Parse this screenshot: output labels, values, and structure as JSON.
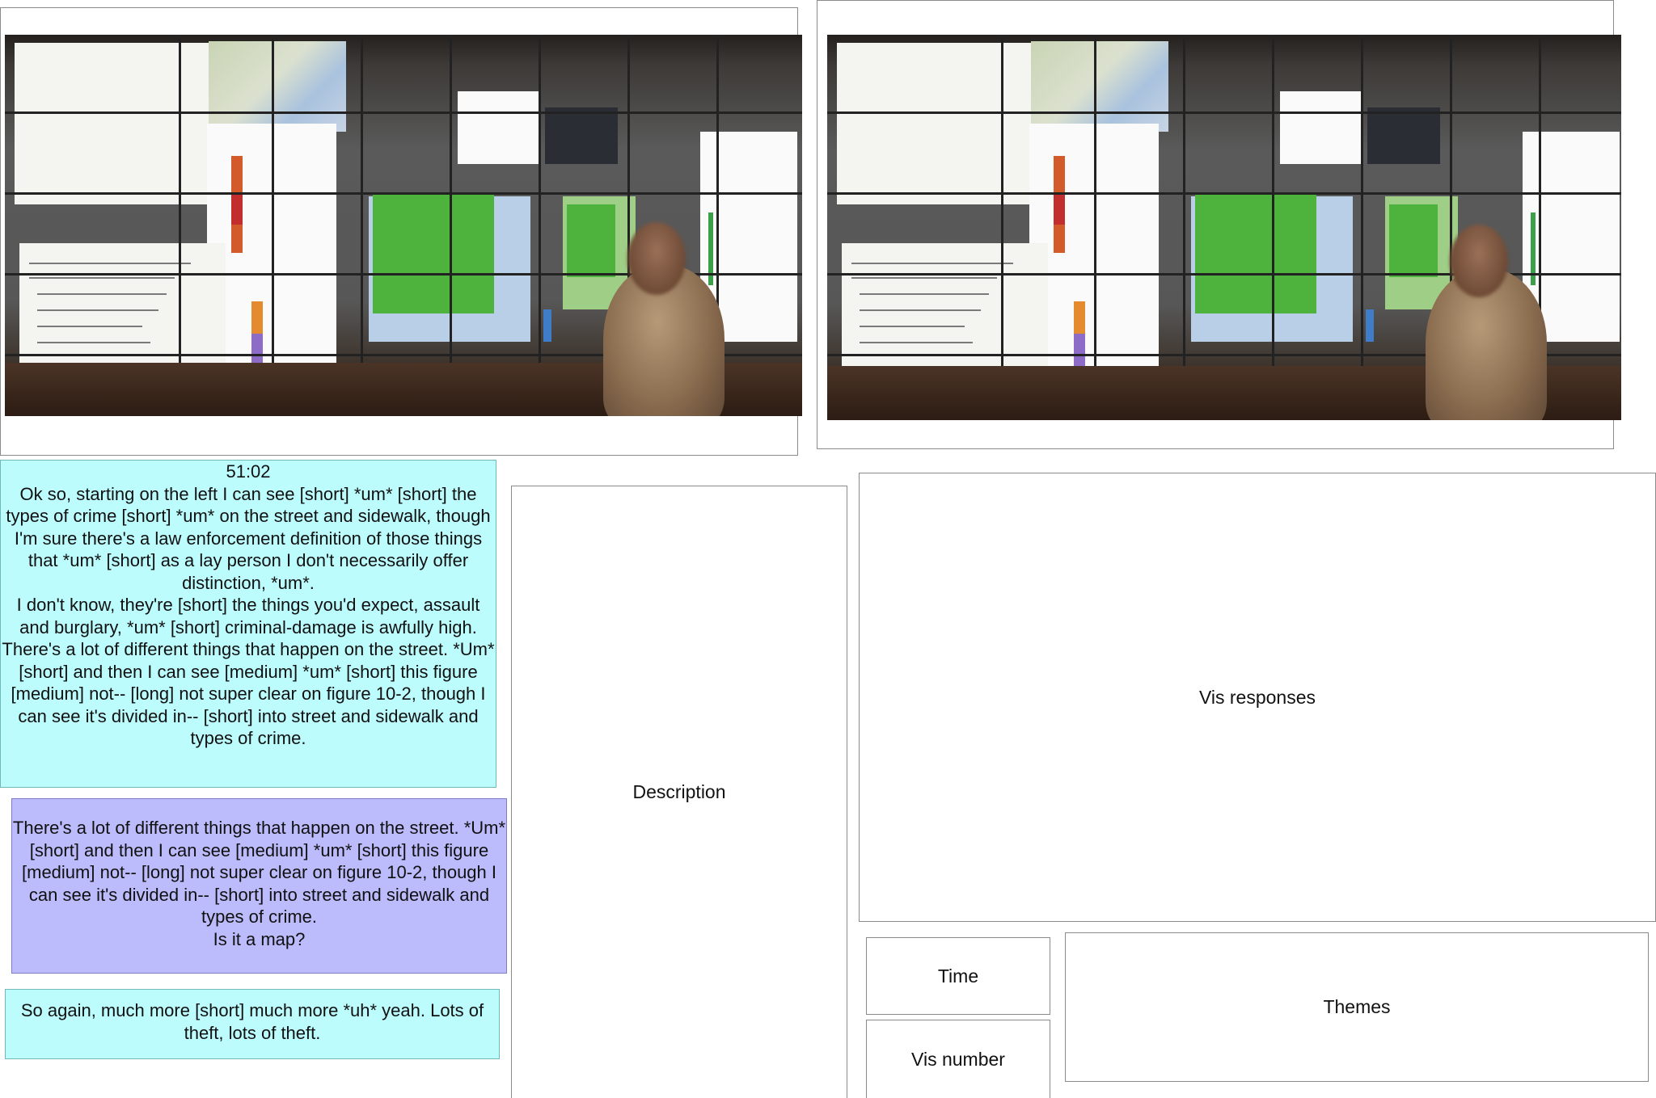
{
  "timestamp": "51:02",
  "transcript_main": [
    "Ok so, starting on the left I can see [short] *um* [short] the types of crime [short] *um* on the street and sidewalk, though I'm sure there's a law enforcement definition of those things that *um* [short] as a lay person I don't necessarily offer distinction, *um*.",
    "I don't know, they're [short] the things you'd expect, assault and burglary, *um* [short] criminal-damage is awfully high.",
    "There's a lot of different things that happen on the street. *Um* [short] and then I can see [medium] *um* [short] this figure [medium] not-- [long] not super clear on figure 10-2, though I can see it's divided in-- [short] into street and sidewalk and types of crime."
  ],
  "transcript_selected": [
    "There's a lot of different things that happen on the street. *Um* [short] and then I can see [medium] *um* [short] this figure [medium] not-- [long] not super clear on figure 10-2, though I can see it's divided in-- [short] into street and sidewalk and types of crime.",
    "Is it a map?"
  ],
  "transcript_next": "So again, much more [short] much more *uh* yeah. Lots of theft, lots of theft.",
  "labels": {
    "description": "Description",
    "vis_responses": "Vis responses",
    "time": "Time",
    "vis_number": "Vis number",
    "themes": "Themes"
  },
  "colors": {
    "cyan_box": "#bdfcfd",
    "violet_box": "#bcbbfc"
  }
}
